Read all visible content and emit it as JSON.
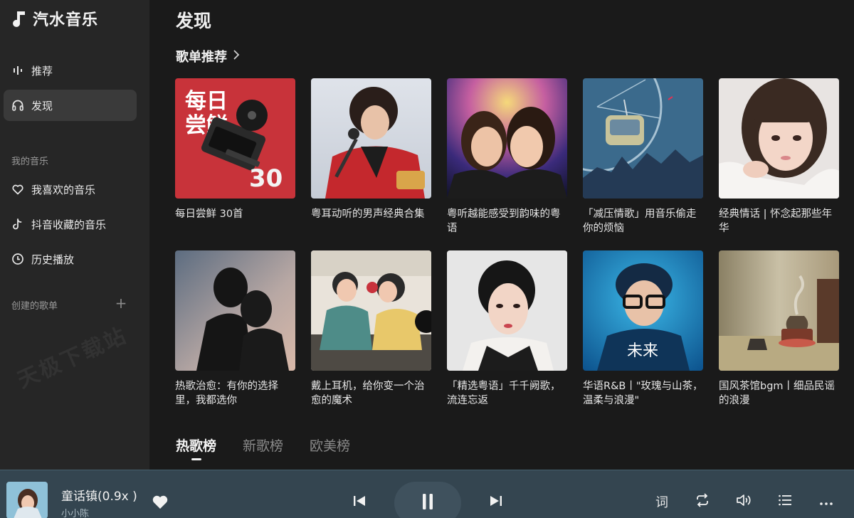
{
  "app": {
    "name": "汽水音乐"
  },
  "sidebar": {
    "nav": [
      {
        "label": "推荐",
        "icon": "recommend-icon"
      },
      {
        "label": "发现",
        "icon": "headphones-icon",
        "active": true
      }
    ],
    "my_music_label": "我的音乐",
    "my_music": [
      {
        "label": "我喜欢的音乐",
        "icon": "heart-outline-icon"
      },
      {
        "label": "抖音收藏的音乐",
        "icon": "tiktok-icon"
      },
      {
        "label": "历史播放",
        "icon": "clock-icon"
      }
    ],
    "created_label": "创建的歌单",
    "add_symbol": "+",
    "watermark": "天极下载站"
  },
  "main": {
    "title": "发现",
    "section_title": "歌单推荐",
    "playlists": [
      {
        "title": "每日尝鲜 30首",
        "cover_text_top": "每日",
        "cover_text_mid": "尝鲜",
        "cover_number": "30"
      },
      {
        "title": "粤耳动听的男声经典合集"
      },
      {
        "title": "粤听越能感受到韵味的粤语"
      },
      {
        "title": "「减压情歌」用音乐偷走你的烦恼"
      },
      {
        "title": "经典情话 | 怀念起那些年华"
      },
      {
        "title": "热歌治愈：有你的选择里，我都选你"
      },
      {
        "title": "戴上耳机，给你变一个治愈的魔术"
      },
      {
        "title": "「精选粤语」千千阙歌，流连忘返"
      },
      {
        "title": "华语R&B丨\"玫瑰与山茶，温柔与浪漫\"",
        "cover_text": "未来"
      },
      {
        "title": "国风茶馆bgm丨细品民谣的浪漫"
      }
    ],
    "tabs": [
      {
        "label": "热歌榜",
        "active": true
      },
      {
        "label": "新歌榜"
      },
      {
        "label": "欧美榜"
      }
    ]
  },
  "player": {
    "song": "童话镇(0.9x )",
    "artist": "小小陈",
    "lyrics_label": "词"
  }
}
